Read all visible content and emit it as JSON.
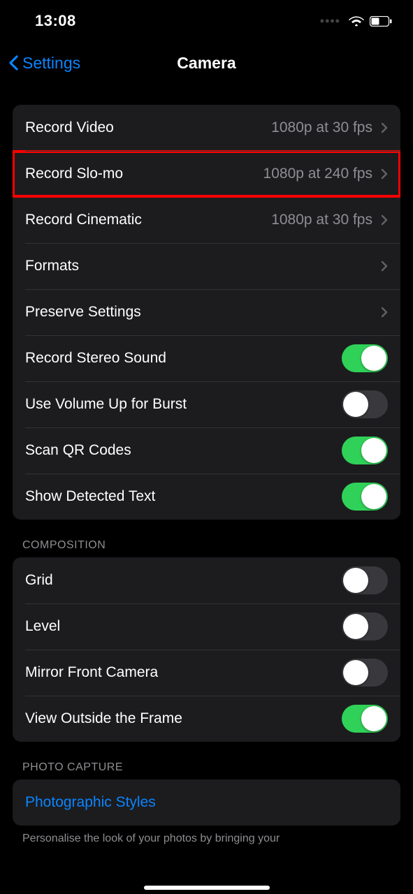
{
  "status": {
    "time": "13:08"
  },
  "nav": {
    "back": "Settings",
    "title": "Camera"
  },
  "group1": {
    "record_video": {
      "label": "Record Video",
      "value": "1080p at 30 fps"
    },
    "record_slomo": {
      "label": "Record Slo-mo",
      "value": "1080p at 240 fps"
    },
    "record_cinematic": {
      "label": "Record Cinematic",
      "value": "1080p at 30 fps"
    },
    "formats": {
      "label": "Formats"
    },
    "preserve": {
      "label": "Preserve Settings"
    },
    "stereo": {
      "label": "Record Stereo Sound",
      "on": true
    },
    "volume_burst": {
      "label": "Use Volume Up for Burst",
      "on": false
    },
    "scan_qr": {
      "label": "Scan QR Codes",
      "on": true
    },
    "detected_text": {
      "label": "Show Detected Text",
      "on": true
    }
  },
  "composition": {
    "header": "COMPOSITION",
    "grid": {
      "label": "Grid",
      "on": false
    },
    "level": {
      "label": "Level",
      "on": false
    },
    "mirror": {
      "label": "Mirror Front Camera",
      "on": false
    },
    "outside_frame": {
      "label": "View Outside the Frame",
      "on": true
    }
  },
  "photo_capture": {
    "header": "PHOTO CAPTURE",
    "styles": {
      "label": "Photographic Styles"
    },
    "footer": "Personalise the look of your photos by bringing your"
  }
}
